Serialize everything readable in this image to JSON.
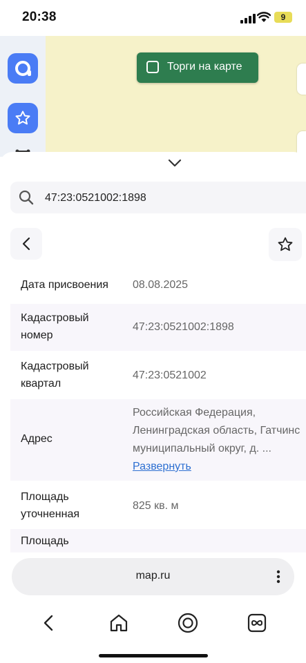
{
  "status": {
    "time": "20:38",
    "battery": "9"
  },
  "map": {
    "auctions_label": "Торги на карте"
  },
  "search": {
    "value": "47:23:0521002:1898"
  },
  "details": [
    {
      "label": "Дата присвоения",
      "value": "08.08.2025"
    },
    {
      "label": "Кадастровый номер",
      "value": "47:23:0521002:1898"
    },
    {
      "label": "Кадастровый квартал",
      "value": "47:23:0521002"
    },
    {
      "label": "Адрес",
      "value_lines": [
        "Российская Федерация,",
        "Ленинградская область, Гатчинс",
        "муниципальный округ, д. ..."
      ],
      "expand": "Развернуть"
    },
    {
      "label": "Площадь уточненная",
      "value": "825 кв. м"
    },
    {
      "label": "Площадь",
      "value": ""
    }
  ],
  "browser": {
    "url": "map.ru"
  },
  "icons": {
    "app": "app-logo-icon",
    "favorite": "star-icon",
    "route": "route-icon",
    "collapse": "chevron-down-icon",
    "search": "search-icon",
    "back": "chevron-left-icon",
    "menu": "more-vertical-icon",
    "home": "home-icon",
    "assistant": "assistant-icon",
    "tabs": "tabs-icon"
  },
  "colors": {
    "accent": "#4a7cf5",
    "auctions": "#2e7d4f",
    "link": "#2d6fd1",
    "map": "#f6f2c9"
  }
}
